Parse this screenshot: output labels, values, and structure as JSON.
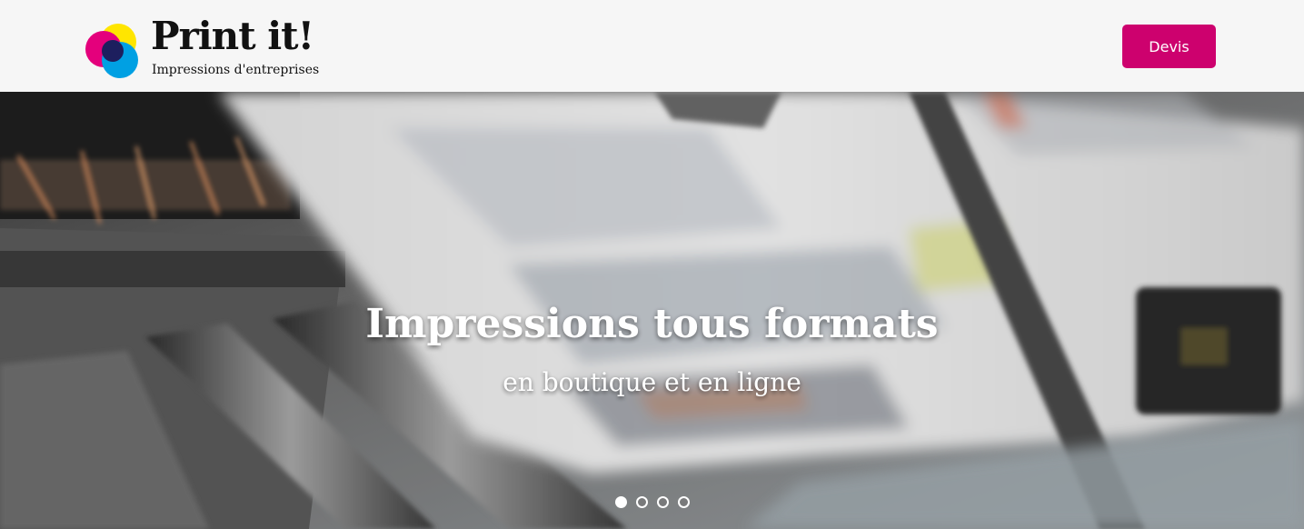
{
  "header": {
    "logo_title": "Print it!",
    "logo_tagline": "Impressions d'entreprises",
    "devis_label": "Devis",
    "accent_color": "#cd016e"
  },
  "hero": {
    "title": "Impressions tous formats",
    "subtitle": "en boutique et en ligne",
    "slides_count": 4,
    "active_slide": 1
  },
  "logo_colors": {
    "yellow": "#ffe500",
    "magenta": "#e4007c",
    "cyan": "#00a0e3",
    "navy": "#1d1f5e"
  }
}
